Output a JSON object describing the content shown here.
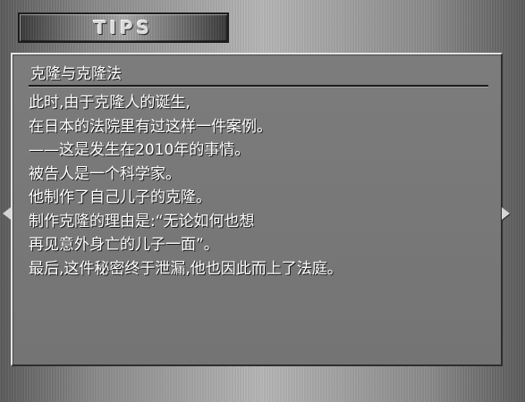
{
  "header": {
    "title": "TIPS"
  },
  "topic": {
    "title": "克隆与克隆法"
  },
  "body": {
    "lines": [
      "此时,由于克隆人的诞生,",
      "在日本的法院里有过这样一件案例。",
      "——这是发生在2010年的事情。",
      "被告人是一个科学家。",
      "他制作了自己儿子的克隆。",
      "制作克隆的理由是:“无论如何也想",
      "再见意外身亡的儿子一面”。",
      "最后,这件秘密终于泄漏,他也因此而上了法庭。"
    ]
  },
  "navigation": {
    "prev_icon": "triangle-left-icon",
    "next_icon": "triangle-right-icon"
  },
  "colors": {
    "text": "#ffffff",
    "panel": "#7a7a7a",
    "frame_metal": "#a0a0a0"
  }
}
